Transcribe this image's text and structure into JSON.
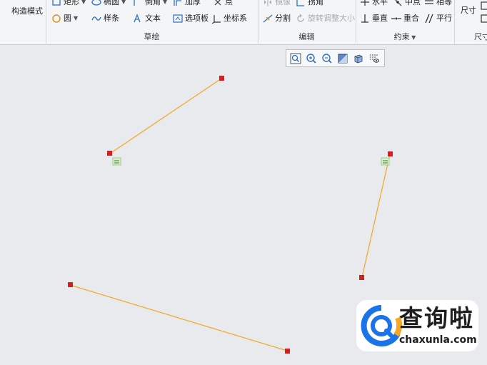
{
  "ribbon": {
    "construction_mode": "构造模式",
    "sketch": {
      "label": "草绘",
      "rect": "矩形",
      "ellipse": "椭圆",
      "fillet": "倒角",
      "thicken": "加厚",
      "point": "点",
      "circle": "圆",
      "spline": "样条",
      "text": "文本",
      "palette": "选项板",
      "coordsys": "坐标系"
    },
    "edit": {
      "label": "编辑",
      "mirror": "镜像",
      "delete_seg": "拐角",
      "divide": "分割",
      "rotate_resize": "旋转调整大小"
    },
    "constrain": {
      "label": "约束",
      "horizontal": "水平",
      "midpoint": "中点",
      "equal": "相等",
      "vertical": "垂直",
      "coincident": "重合",
      "parallel": "平行"
    },
    "dimension": {
      "label": "尺寸",
      "dim": "尺寸"
    }
  },
  "watermark": {
    "title": "查询啦",
    "url": "chaxunla.com"
  },
  "colors": {
    "line": "#f5a623",
    "endpoint": "#d81e1e",
    "constraint": "#4caf50",
    "canvas": "#e8eaee"
  }
}
